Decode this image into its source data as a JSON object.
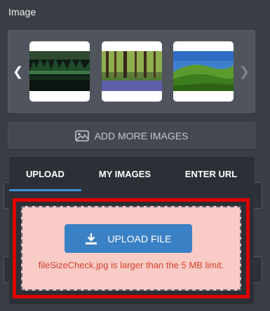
{
  "section": {
    "title": "Image"
  },
  "carousel": {
    "prev_icon": "chevron-left-icon",
    "next_icon": "chevron-right-icon",
    "thumbnails": [
      {
        "name": "forest-lake"
      },
      {
        "name": "bluebell-forest"
      },
      {
        "name": "green-hills"
      }
    ]
  },
  "add_more": {
    "label": "ADD MORE IMAGES",
    "icon": "image-icon"
  },
  "tabs": [
    {
      "label": "UPLOAD",
      "active": true
    },
    {
      "label": "MY IMAGES",
      "active": false
    },
    {
      "label": "ENTER URL",
      "active": false
    }
  ],
  "dropzone": {
    "button_label": "UPLOAD FILE",
    "button_icon": "download-icon",
    "error": "fileSizeCheck.jpg is larger than the 5 MB limit."
  },
  "colors": {
    "background": "#3a3d45",
    "accent": "#3a80c4",
    "tab_indicator": "#3f90d4",
    "error_text": "#d4422b",
    "dropzone_bg": "#f8cbc7",
    "highlight": "#e00000"
  }
}
